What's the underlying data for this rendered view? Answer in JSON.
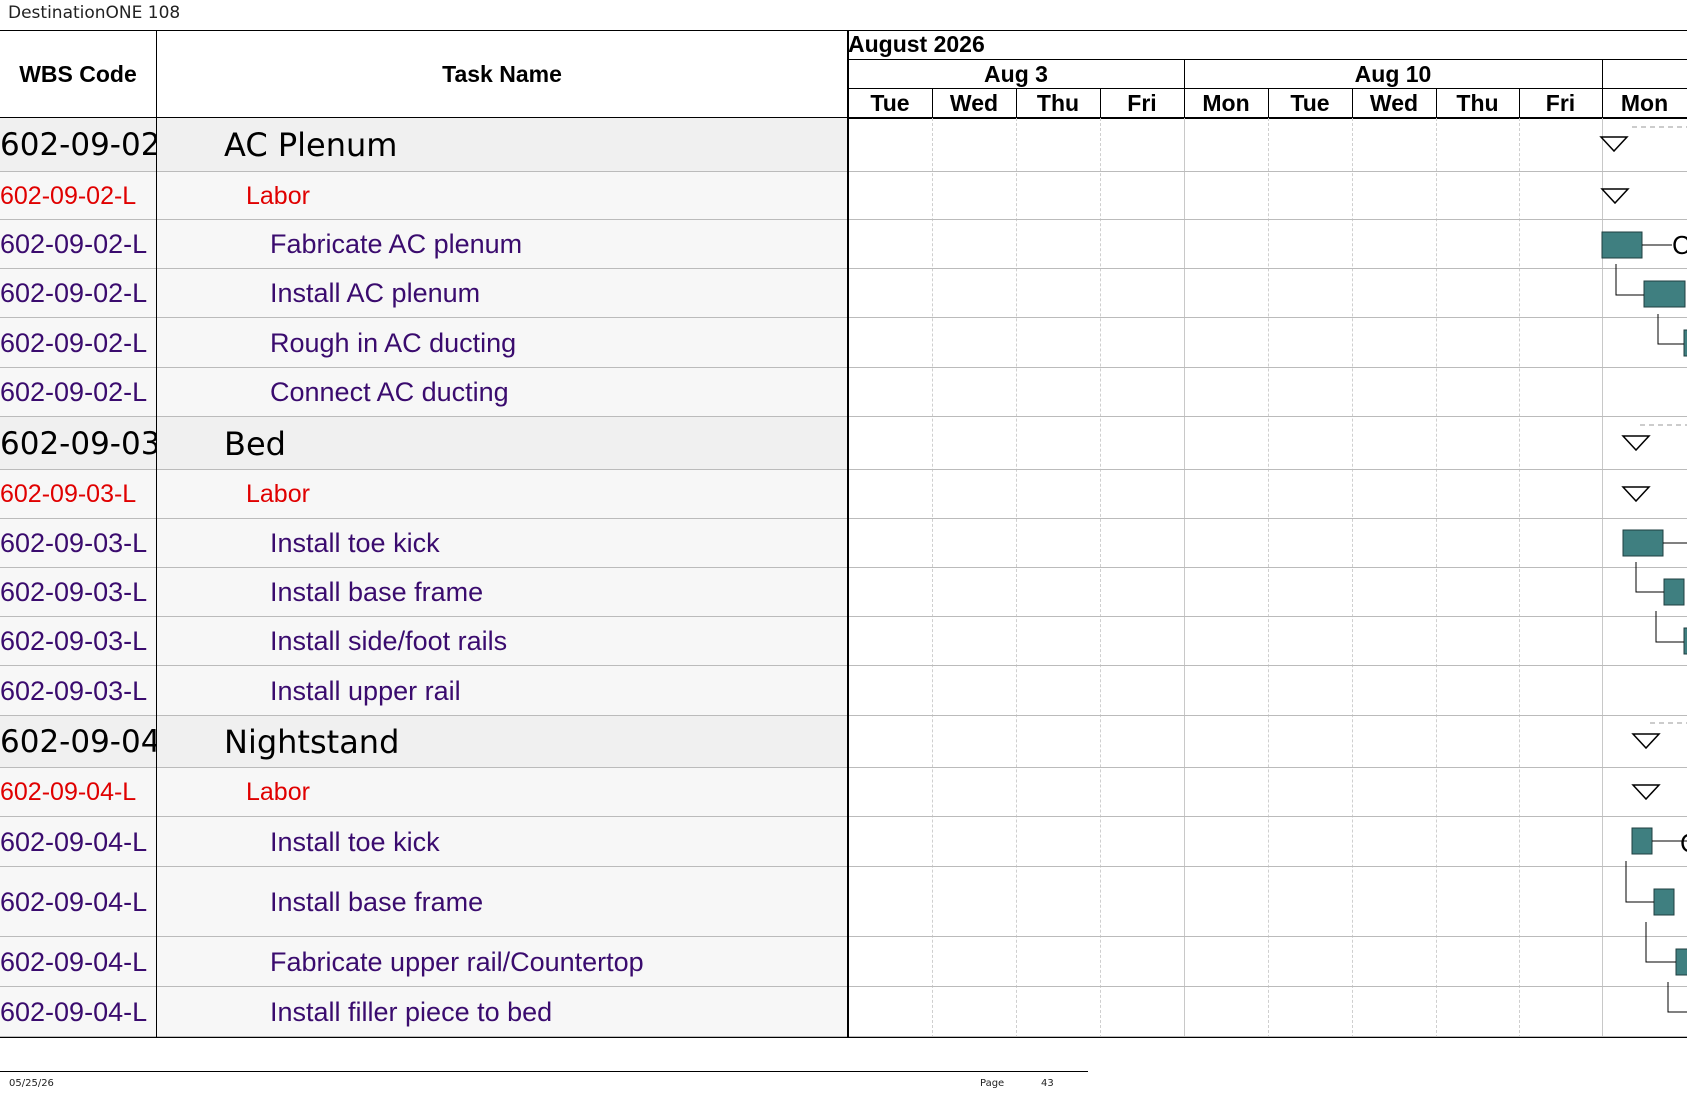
{
  "document": {
    "title": "DestinationONE 108"
  },
  "columns": {
    "wbs_header": "WBS Code",
    "task_header": "Task Name"
  },
  "timeline": {
    "month": "August 2026",
    "weeks": [
      {
        "label": "Aug 3"
      },
      {
        "label": "Aug 10"
      }
    ],
    "days": [
      "Tue",
      "Wed",
      "Thu",
      "Fri",
      "Mon",
      "Tue",
      "Wed",
      "Thu",
      "Fri",
      "Mon"
    ]
  },
  "rows": [
    {
      "wbs": "602-09-02",
      "name": "AC Plenum",
      "level": "summary"
    },
    {
      "wbs": "602-09-02-L",
      "name": "Labor",
      "level": "labor"
    },
    {
      "wbs": "602-09-02-L",
      "name": "Fabricate AC plenum",
      "level": "task"
    },
    {
      "wbs": "602-09-02-L",
      "name": "Install AC plenum",
      "level": "task"
    },
    {
      "wbs": "602-09-02-L",
      "name": "Rough in AC ducting",
      "level": "task"
    },
    {
      "wbs": "602-09-02-L",
      "name": "Connect AC ducting",
      "level": "task"
    },
    {
      "wbs": "602-09-03",
      "name": "Bed",
      "level": "summary"
    },
    {
      "wbs": "602-09-03-L",
      "name": "Labor",
      "level": "labor"
    },
    {
      "wbs": "602-09-03-L",
      "name": "Install toe kick",
      "level": "task"
    },
    {
      "wbs": "602-09-03-L",
      "name": "Install base frame",
      "level": "task"
    },
    {
      "wbs": "602-09-03-L",
      "name": "Install side/foot rails",
      "level": "task"
    },
    {
      "wbs": "602-09-03-L",
      "name": "Install upper rail",
      "level": "task"
    },
    {
      "wbs": "602-09-04",
      "name": "Nightstand",
      "level": "summary"
    },
    {
      "wbs": "602-09-04-L",
      "name": "Labor",
      "level": "labor"
    },
    {
      "wbs": "602-09-04-L",
      "name": "Install toe kick",
      "level": "task"
    },
    {
      "wbs": "602-09-04-L",
      "name": "Install base frame",
      "level": "task"
    },
    {
      "wbs": "602-09-04-L",
      "name": "Fabricate upper rail/Countertop",
      "level": "task"
    },
    {
      "wbs": "602-09-04-L",
      "name": "Install filler piece to bed",
      "level": "task"
    }
  ],
  "bar_labels": [
    "C",
    "C"
  ],
  "colors": {
    "bar_fill": "#3f7f80",
    "labor_text": "#e00000",
    "task_text": "#3a0b6e"
  },
  "footer": {
    "date": "05/25/26",
    "page_label": "Page",
    "page_number": "43"
  }
}
